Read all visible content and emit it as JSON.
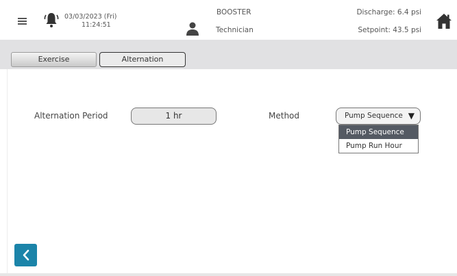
{
  "header": {
    "date": "03/03/2023 (Fri)",
    "time": "11:24:51",
    "mode": "BOOSTER",
    "role": "Technician",
    "discharge": "Discharge: 6.4 psi",
    "setpoint": "Setpoint: 43.5 psi"
  },
  "icons": {
    "menu": "menu-icon",
    "bell": "bell-icon",
    "user": "user-icon",
    "home": "home-icon",
    "back": "chevron-left-icon"
  },
  "tabs": [
    {
      "label": "Exercise"
    },
    {
      "label": "Alternation"
    }
  ],
  "form": {
    "alternation_label": "Alternation Period",
    "alternation_value": "1 hr",
    "method_label": "Method",
    "method_value": "Pump Sequence",
    "method_options": [
      "Pump Sequence",
      "Pump Run Hour"
    ]
  },
  "colors": {
    "accent": "#1b84a9",
    "selected_option": "#545a63",
    "tabbar": "#e1e1e3"
  }
}
